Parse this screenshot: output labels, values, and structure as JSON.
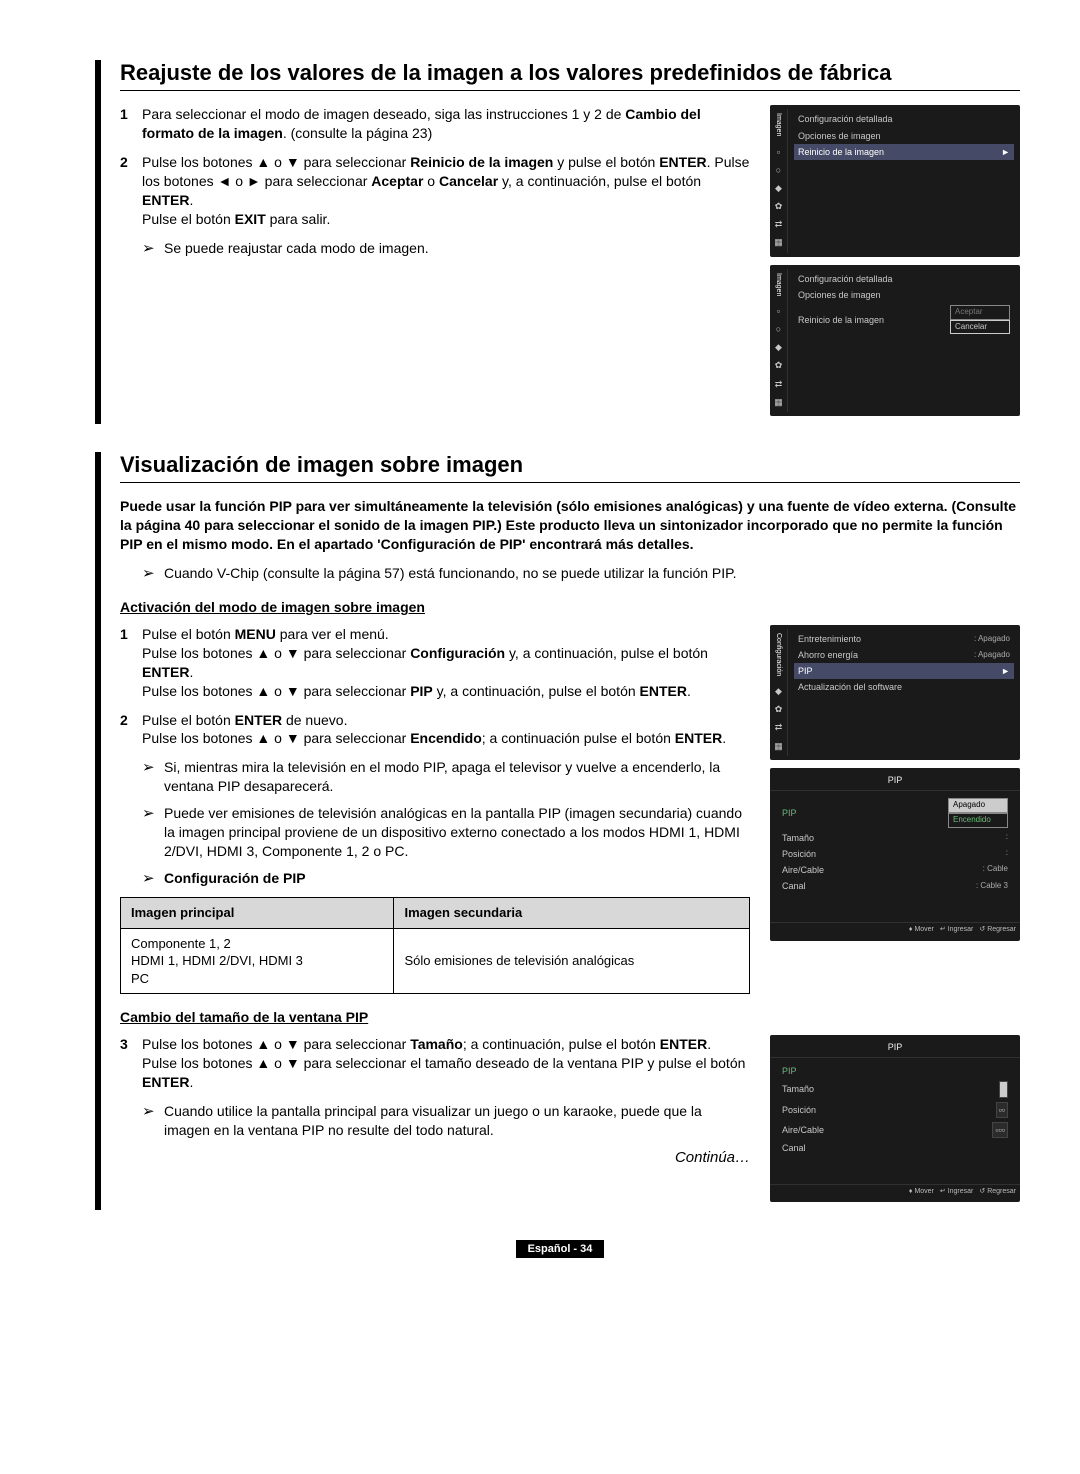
{
  "section1": {
    "title": "Reajuste de los valores de la imagen a los valores predefinidos de fábrica",
    "step1_num": "1",
    "step1_a": "Para seleccionar el modo de imagen deseado, siga las instrucciones 1 y 2 de ",
    "step1_b": "Cambio del formato de la imagen",
    "step1_c": ". (consulte la página 23)",
    "step2_num": "2",
    "step2_a": "Pulse los botones ▲ o ▼ para seleccionar ",
    "step2_b": "Reinicio de la imagen",
    "step2_c": " y pulse el botón ",
    "step2_d": "ENTER",
    "step2_e": ". Pulse los botones ◄ o ► para seleccionar ",
    "step2_f": "Aceptar",
    "step2_g": " o ",
    "step2_h": "Cancelar",
    "step2_i": " y, a continuación, pulse el botón ",
    "step2_j": "ENTER",
    "step2_k": ".",
    "step2_exit": "Pulse el botón ",
    "step2_exit_b": "EXIT",
    "step2_exit_c": " para salir.",
    "note": "Se puede reajustar cada modo de imagen."
  },
  "menu1": {
    "tab": "Imagen",
    "r1": "Configuración detallada",
    "r2": "Opciones de imagen",
    "r3": "Reinicio de la imagen"
  },
  "menu2": {
    "tab": "Imagen",
    "r1": "Configuración detallada",
    "r2": "Opciones de imagen",
    "r3": "Reinicio de la imagen",
    "opt1": "Aceptar",
    "opt2": "Cancelar"
  },
  "section2": {
    "title": "Visualización de imagen sobre imagen",
    "intro": "Puede usar la función PIP para ver simultáneamente la televisión (sólo emisiones analógicas) y una fuente de vídeo externa. (Consulte la página 40 para seleccionar el sonido de la imagen PIP.) Este producto lleva un sintonizador incorporado que no permite la función PIP en el mismo modo. En el apartado 'Configuración de PIP' encontrará más detalles.",
    "note1": "Cuando V-Chip (consulte la página 57) está funcionando, no se puede utilizar la función PIP.",
    "sub1": "Activación del modo de imagen sobre imagen",
    "s1_num": "1",
    "s1_a": "Pulse el botón ",
    "s1_b": "MENU",
    "s1_c": " para ver el menú.",
    "s1_d": "Pulse los botones ▲ o ▼ para seleccionar ",
    "s1_e": "Configuración",
    "s1_f": " y, a continuación, pulse el botón ",
    "s1_g": "ENTER",
    "s1_h": ".",
    "s1_i": "Pulse los botones ▲ o ▼ para seleccionar ",
    "s1_j": "PIP",
    "s1_k": " y, a continuación, pulse el botón ",
    "s1_l": "ENTER",
    "s1_m": ".",
    "s2_num": "2",
    "s2_a": "Pulse el botón ",
    "s2_b": "ENTER",
    "s2_c": " de nuevo.",
    "s2_d": "Pulse los botones ▲ o ▼ para seleccionar ",
    "s2_e": "Encendido",
    "s2_f": "; a continuación pulse el botón ",
    "s2_g": "ENTER",
    "s2_h": ".",
    "pnote1": "Si, mientras mira la televisión en el modo PIP, apaga el televisor y vuelve a encenderlo, la ventana PIP desaparecerá.",
    "pnote2": "Puede ver emisiones de televisión analógicas en la pantalla PIP (imagen secundaria) cuando la imagen principal proviene de un dispositivo externo conectado a los modos HDMI 1, HDMI 2/DVI, HDMI 3, Componente 1, 2 o PC.",
    "conf_pip": "Configuración de PIP",
    "th1": "Imagen principal",
    "th2": "Imagen secundaria",
    "td1": "Componente 1, 2\nHDMI 1, HDMI 2/DVI, HDMI 3\nPC",
    "td2": "Sólo emisiones de televisión analógicas",
    "sub2": "Cambio del tamaño de la ventana PIP",
    "s3_num": "3",
    "s3_a": "Pulse los botones ▲ o ▼ para seleccionar ",
    "s3_b": "Tamaño",
    "s3_c": "; a continuación, pulse el botón ",
    "s3_d": "ENTER",
    "s3_e": ".",
    "s3_f": "Pulse los botones ▲ o ▼ para seleccionar el tamaño deseado de la ventana PIP y pulse el botón ",
    "s3_g": "ENTER",
    "s3_h": ".",
    "pnote3": "Cuando utilice la pantalla principal para visualizar un juego o un karaoke, puede que la imagen en la ventana PIP no resulte del todo natural.",
    "continua": "Continúa…"
  },
  "menu3": {
    "tab": "Configuración",
    "r1": "Entretenimiento",
    "v1": ": Apagado",
    "r2": "Ahorro energía",
    "v2": ": Apagado",
    "r3": "PIP",
    "r4": "Actualización del software"
  },
  "menu4": {
    "title": "PIP",
    "r1": "PIP",
    "opt1": "Apagado",
    "opt2": "Encendido",
    "r2": "Tamaño",
    "v2": ":",
    "r3": "Posición",
    "v3": ":",
    "r4": "Aire/Cable",
    "v4": ": Cable",
    "r5": "Canal",
    "v5": ": Cable 3",
    "f1": "Mover",
    "f2": "Ingresar",
    "f3": "Regresar"
  },
  "menu5": {
    "title": "PIP",
    "r1": "PIP",
    "r2": "Tamaño",
    "r3": "Posición",
    "r4": "Aire/Cable",
    "r5": "Canal",
    "f1": "Mover",
    "f2": "Ingresar",
    "f3": "Regresar"
  },
  "footer": "Español - 34"
}
